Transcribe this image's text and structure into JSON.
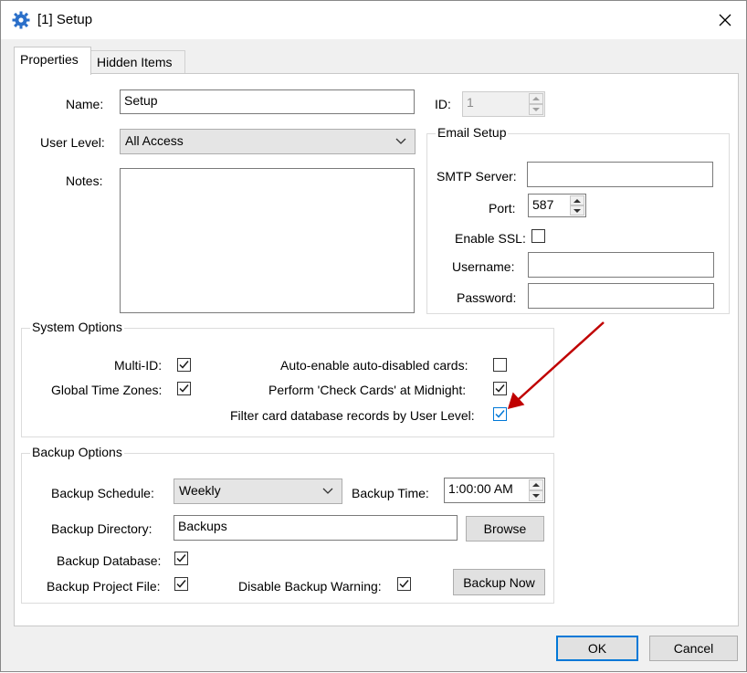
{
  "window": {
    "title": "[1] Setup",
    "close_glyph": "✕"
  },
  "tabs": [
    {
      "label": "Properties",
      "active": true
    },
    {
      "label": "Hidden Items",
      "active": false
    }
  ],
  "properties": {
    "name_label": "Name:",
    "name_value": "Setup",
    "id_label": "ID:",
    "id_value": "1",
    "user_level_label": "User Level:",
    "user_level_value": "All Access",
    "notes_label": "Notes:",
    "notes_value": ""
  },
  "email_setup": {
    "title": "Email Setup",
    "smtp_label": "SMTP Server:",
    "smtp_value": "",
    "port_label": "Port:",
    "port_value": "587",
    "ssl_label": "Enable SSL:",
    "ssl_checked": false,
    "username_label": "Username:",
    "username_value": "",
    "password_label": "Password:",
    "password_value": ""
  },
  "system_options": {
    "title": "System Options",
    "multi_id_label": "Multi-ID:",
    "multi_id_checked": true,
    "global_tz_label": "Global Time Zones:",
    "global_tz_checked": true,
    "auto_enable_label": "Auto-enable auto-disabled cards:",
    "auto_enable_checked": false,
    "check_cards_label": "Perform 'Check Cards' at Midnight:",
    "check_cards_checked": true,
    "filter_label": "Filter card database records by User Level:",
    "filter_checked": true
  },
  "backup_options": {
    "title": "Backup Options",
    "schedule_label": "Backup Schedule:",
    "schedule_value": "Weekly",
    "time_label": "Backup Time:",
    "time_value": "1:00:00 AM",
    "directory_label": "Backup Directory:",
    "directory_value": "Backups",
    "browse_label": "Browse",
    "database_label": "Backup Database:",
    "database_checked": true,
    "project_label": "Backup Project File:",
    "project_checked": true,
    "warning_label": "Disable Backup Warning:",
    "warning_checked": true,
    "backup_now_label": "Backup Now"
  },
  "footer": {
    "ok_label": "OK",
    "cancel_label": "Cancel"
  },
  "colors": {
    "accent": "#0078d7",
    "annotation_arrow": "#c00000",
    "check_mark": "#1a1a1a"
  }
}
